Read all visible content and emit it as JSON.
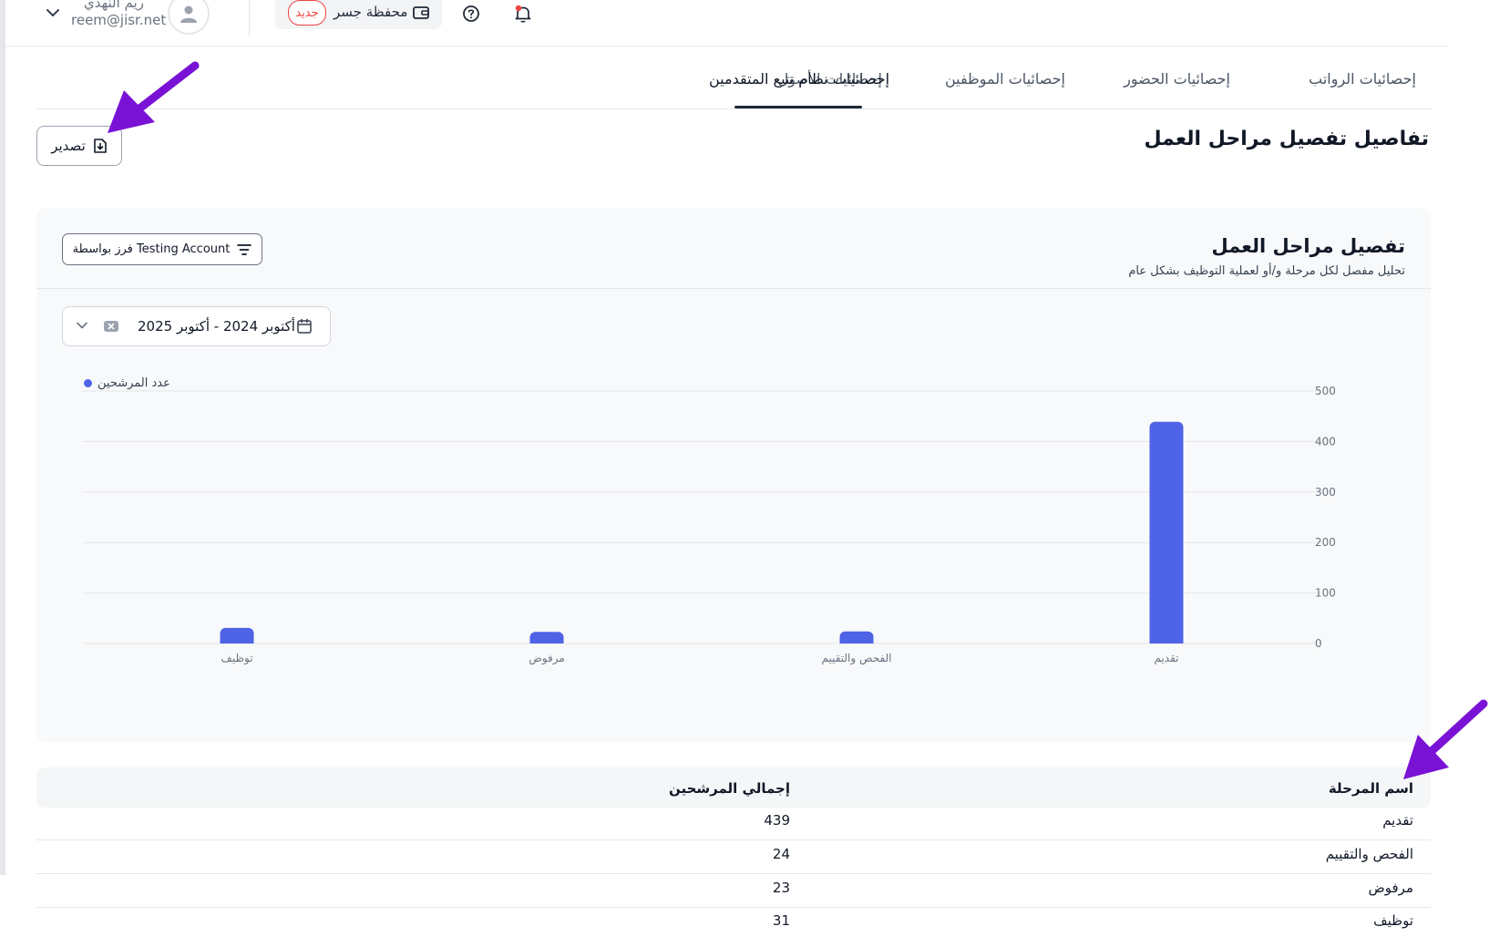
{
  "header": {
    "user_name": "ريم النهدي",
    "user_email": "reem@jisr.net",
    "wallet_label": "محفظة جسر",
    "new_badge": "جديد"
  },
  "tabs": [
    {
      "label": "إحصائيات الرواتب",
      "active": false
    },
    {
      "label": "إحصائيات الحضور",
      "active": false
    },
    {
      "label": "إحصائيات الموظفين",
      "active": false
    },
    {
      "label": "إحصائيات الأصول",
      "active": false
    },
    {
      "label": "إحصائيات نظام تتبع المتقدمين",
      "active": true
    }
  ],
  "page": {
    "title": "تفاصيل تفصيل مراحل العمل",
    "export_label": "تصدير"
  },
  "card": {
    "title": "تفصيل مراحل العمل",
    "subtitle": "تحليل مفصل لكل مرحلة و/أو لعملية التوظيف بشكل عام",
    "filter_label": "فرز بواسطة Testing Account",
    "date_range": "أكتوبر 2024 - أكتوبر 2025"
  },
  "chart_data": {
    "type": "bar",
    "categories": [
      "تقديم",
      "الفحص والتقييم",
      "مرفوض",
      "توظيف"
    ],
    "series": [
      {
        "name": "عدد المرشحين",
        "values": [
          439,
          24,
          23,
          31
        ],
        "color": "#4f63e6"
      }
    ],
    "ylim": [
      0,
      500
    ],
    "yticks": [
      "0",
      "100",
      "200",
      "300",
      "400",
      "500"
    ],
    "grid": true,
    "legend": "top-left"
  },
  "table": {
    "headers": {
      "name": "اسم المرحلة",
      "total": "إجمالي المرشحين"
    },
    "rows": [
      {
        "name": "تقديم",
        "total": "439"
      },
      {
        "name": "الفحص والتقييم",
        "total": "24"
      },
      {
        "name": "مرفوض",
        "total": "23"
      },
      {
        "name": "توظيف",
        "total": "31"
      }
    ]
  },
  "colors": {
    "accent": "#4f63e6",
    "annotation": "#7a12d6",
    "badge": "#ef4444"
  }
}
